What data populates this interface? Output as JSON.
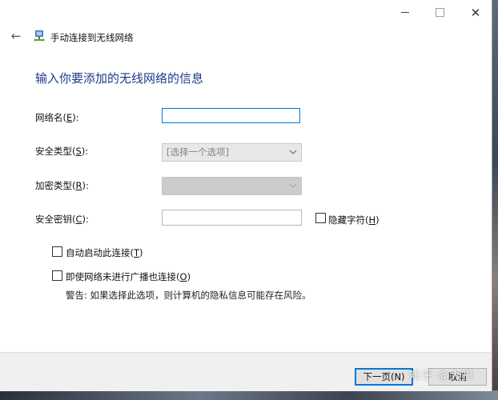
{
  "window": {
    "minimize_glyph": "",
    "maximize_glyph": "",
    "close_glyph": "✕"
  },
  "header": {
    "back_glyph": "←",
    "title": "手动连接到无线网络"
  },
  "main": {
    "heading": "输入你要添加的无线网络的信息",
    "fields": {
      "network_name": {
        "label_pre": "网络名(",
        "mnemonic": "E",
        "label_post": "):",
        "value": ""
      },
      "security_type": {
        "label_pre": "安全类型(",
        "mnemonic": "S",
        "label_post": "):",
        "selected": "[选择一个选项]"
      },
      "encryption_type": {
        "label_pre": "加密类型(",
        "mnemonic": "R",
        "label_post": "):",
        "selected": ""
      },
      "security_key": {
        "label_pre": "安全密钥(",
        "mnemonic": "C",
        "label_post": "):",
        "value": ""
      }
    },
    "hide_chars": {
      "label_pre": "隐藏字符(",
      "mnemonic": "H",
      "label_post": ")",
      "checked": false
    },
    "auto_connect": {
      "label_pre": "自动启动此连接(",
      "mnemonic": "T",
      "label_post": ")",
      "checked": false
    },
    "connect_hidden": {
      "label_pre": "即使网络未进行广播也连接(",
      "mnemonic": "O",
      "label_post": ")",
      "checked": false
    },
    "warning": "警告: 如果选择此选项，则计算机的隐私信息可能存在风险。"
  },
  "footer": {
    "next_label": "下一页(N)",
    "cancel_label": "取消"
  },
  "watermark": "知乎 @大福",
  "colors": {
    "heading": "#1e3b8a",
    "focus_border": "#0078d7",
    "footer_bg": "#f0f0f0"
  },
  "icons": {
    "back": "arrow-left-icon",
    "network": "network-icon",
    "chevron": "chevron-down-icon"
  }
}
